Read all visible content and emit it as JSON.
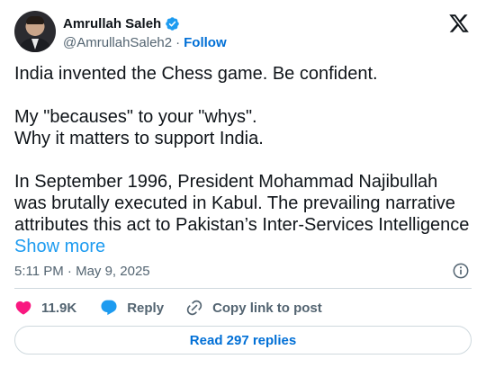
{
  "author": {
    "display_name": "Amrullah Saleh",
    "handle": "@AmrullahSaleh2",
    "separator": "·",
    "follow_label": "Follow",
    "verified": true
  },
  "post": {
    "line1": "India invented the Chess game. Be confident.",
    "line2": "My \"becauses\" to your \"whys\".",
    "line3": "Why it matters to support India.",
    "paragraph3": "In September 1996, President Mohammad Najibullah was brutally executed in Kabul. The prevailing narrative attributes this act to Pakistan’s Inter-Services Intelligence",
    "show_more_label": "Show more"
  },
  "meta": {
    "timestamp": "5:11 PM · May 9, 2025"
  },
  "actions": {
    "likes": "11.9K",
    "reply_label": "Reply",
    "copy_label": "Copy link to post"
  },
  "footer": {
    "read_replies_label": "Read 297 replies"
  },
  "colors": {
    "like_heart": "#f91880",
    "reply_bubble": "#1d9bf0",
    "link_blue": "#006fd6",
    "verified_blue": "#1d9bf0",
    "muted_text": "#536471"
  },
  "icons": [
    "verified-badge-icon",
    "x-logo-icon",
    "info-icon",
    "heart-icon",
    "reply-bubble-icon",
    "link-icon"
  ]
}
